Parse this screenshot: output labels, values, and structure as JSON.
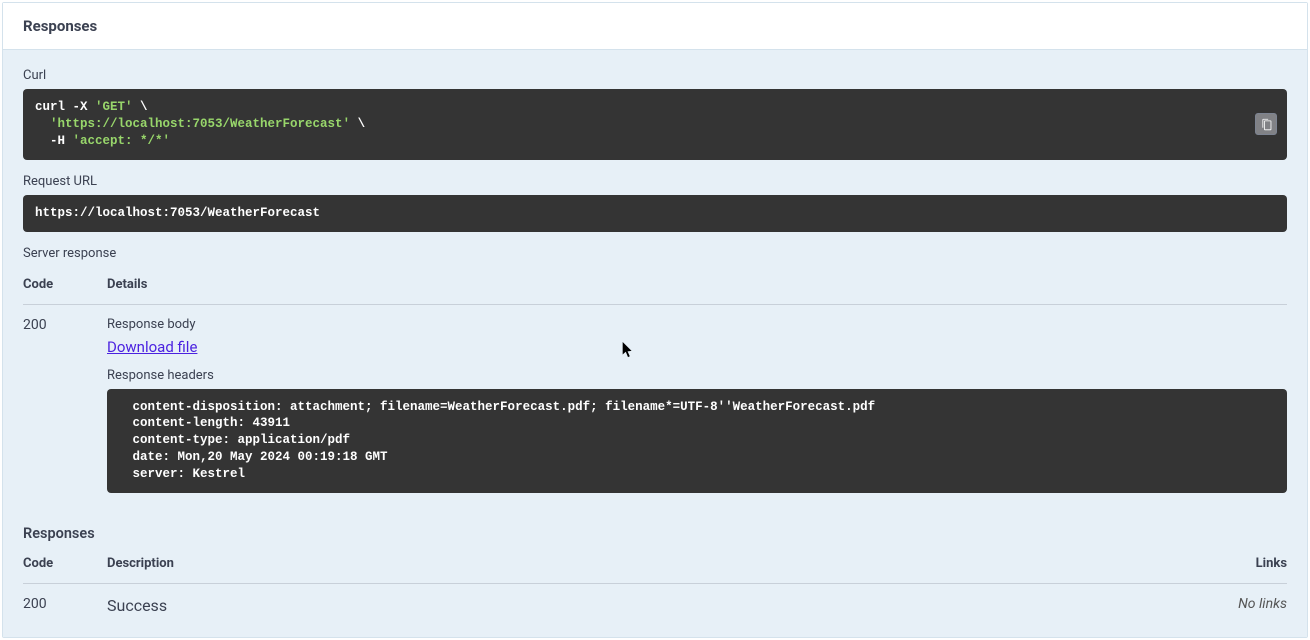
{
  "header": {
    "title": "Responses"
  },
  "curl": {
    "label": "Curl",
    "line1_a": "curl -X ",
    "line1_b": "'GET'",
    "line1_c": " \\",
    "line2_a": "  ",
    "line2_b": "'https://localhost:7053/WeatherForecast'",
    "line2_c": " \\",
    "line3_a": "  -H ",
    "line3_b": "'accept: */*'"
  },
  "request_url": {
    "label": "Request URL",
    "value": "https://localhost:7053/WeatherForecast"
  },
  "server_response": {
    "label": "Server response",
    "code_header": "Code",
    "details_header": "Details",
    "row": {
      "code": "200",
      "response_body_label": "Response body",
      "download_label": "Download file",
      "response_headers_label": "Response headers",
      "headers_text": " content-disposition: attachment; filename=WeatherForecast.pdf; filename*=UTF-8''WeatherForecast.pdf \n content-length: 43911 \n content-type: application/pdf \n date: Mon,20 May 2024 00:19:18 GMT \n server: Kestrel "
    }
  },
  "responses_spec": {
    "label": "Responses",
    "code_header": "Code",
    "description_header": "Description",
    "links_header": "Links",
    "row": {
      "code": "200",
      "description": "Success",
      "links": "No links"
    }
  },
  "icons": {
    "copy": "copy"
  }
}
